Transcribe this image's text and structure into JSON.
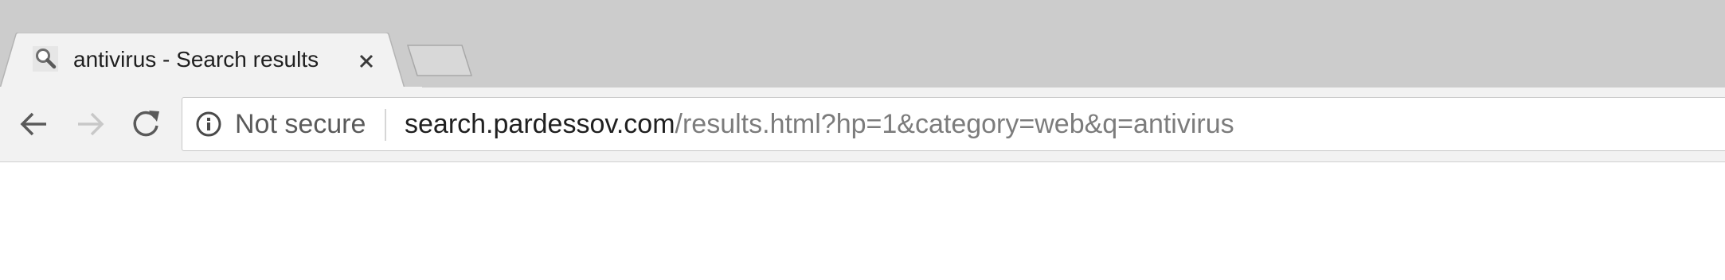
{
  "tab": {
    "title": "antivirus - Search results",
    "favicon_icon": "search-icon"
  },
  "toolbar": {
    "back_icon": "back-arrow-icon",
    "forward_icon": "forward-arrow-icon",
    "reload_icon": "reload-icon"
  },
  "omnibox": {
    "security_icon": "info-icon",
    "security_label": "Not secure",
    "url_host": "search.pardessov.com",
    "url_path": "/results.html?hp=1&category=web&q=antivirus"
  },
  "colors": {
    "tabstrip_bg": "#cccccc",
    "toolbar_bg": "#f2f2f2",
    "url_host": "#202020",
    "url_path": "#7c7c7c"
  }
}
